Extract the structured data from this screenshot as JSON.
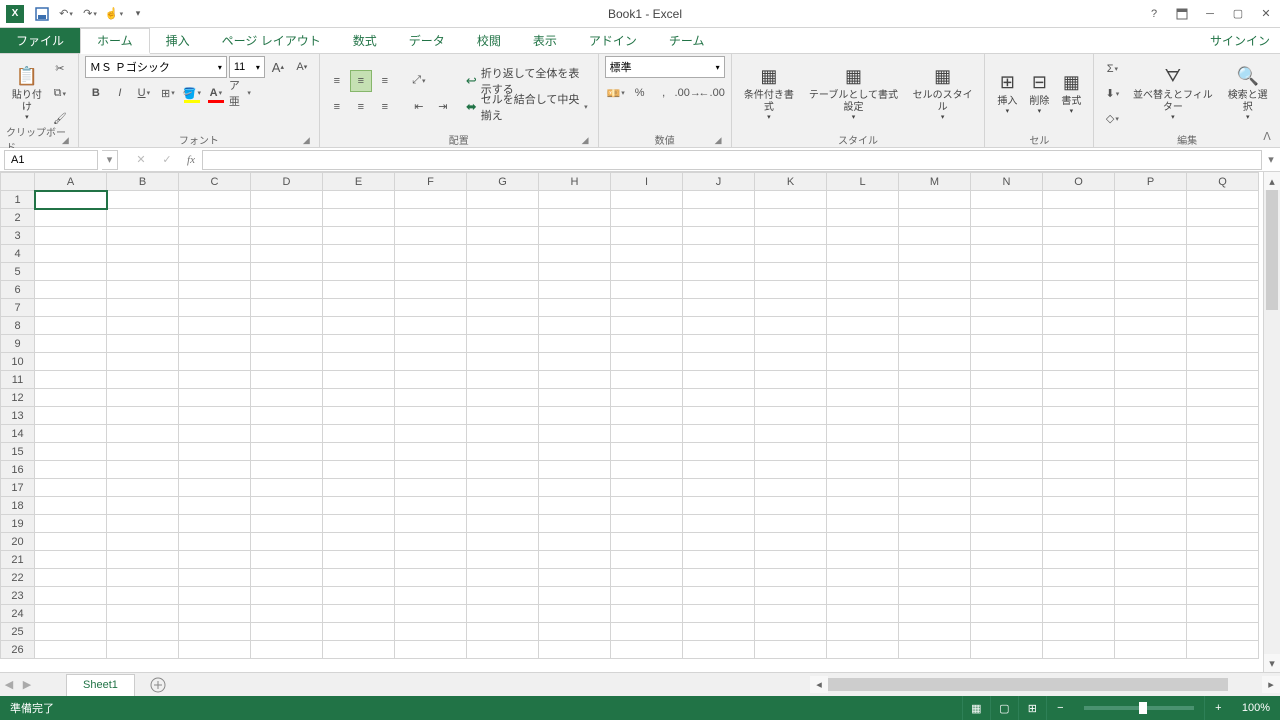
{
  "title": "Book1 - Excel",
  "signin": "サインイン",
  "tabs": {
    "file": "ファイル",
    "home": "ホーム",
    "insert": "挿入",
    "pagelayout": "ページ レイアウト",
    "formulas": "数式",
    "data": "データ",
    "review": "校閲",
    "view": "表示",
    "addin": "アドイン",
    "team": "チーム"
  },
  "ribbon": {
    "clipboard": {
      "label": "クリップボード",
      "paste": "貼り付け"
    },
    "font": {
      "label": "フォント",
      "name": "ＭＳ Ｐゴシック",
      "size": "11"
    },
    "align": {
      "label": "配置",
      "wrap": "折り返して全体を表示する",
      "merge": "セルを結合して中央揃え"
    },
    "number": {
      "label": "数値",
      "format": "標準"
    },
    "styles": {
      "label": "スタイル",
      "conditional": "条件付き書式",
      "table": "テーブルとして書式設定",
      "cell": "セルのスタイル"
    },
    "cells": {
      "label": "セル",
      "insert": "挿入",
      "delete": "削除",
      "format": "書式"
    },
    "editing": {
      "label": "編集",
      "sort": "並べ替えとフィルター",
      "find": "検索と選択"
    }
  },
  "namebox": "A1",
  "sheet": "Sheet1",
  "columns": [
    "A",
    "B",
    "C",
    "D",
    "E",
    "F",
    "G",
    "H",
    "I",
    "J",
    "K",
    "L",
    "M",
    "N",
    "O",
    "P",
    "Q"
  ],
  "rows": [
    1,
    2,
    3,
    4,
    5,
    6,
    7,
    8,
    9,
    10,
    11,
    12,
    13,
    14,
    15,
    16,
    17,
    18,
    19,
    20,
    21,
    22,
    23,
    24,
    25,
    26
  ],
  "status": "準備完了",
  "zoom": "100%"
}
